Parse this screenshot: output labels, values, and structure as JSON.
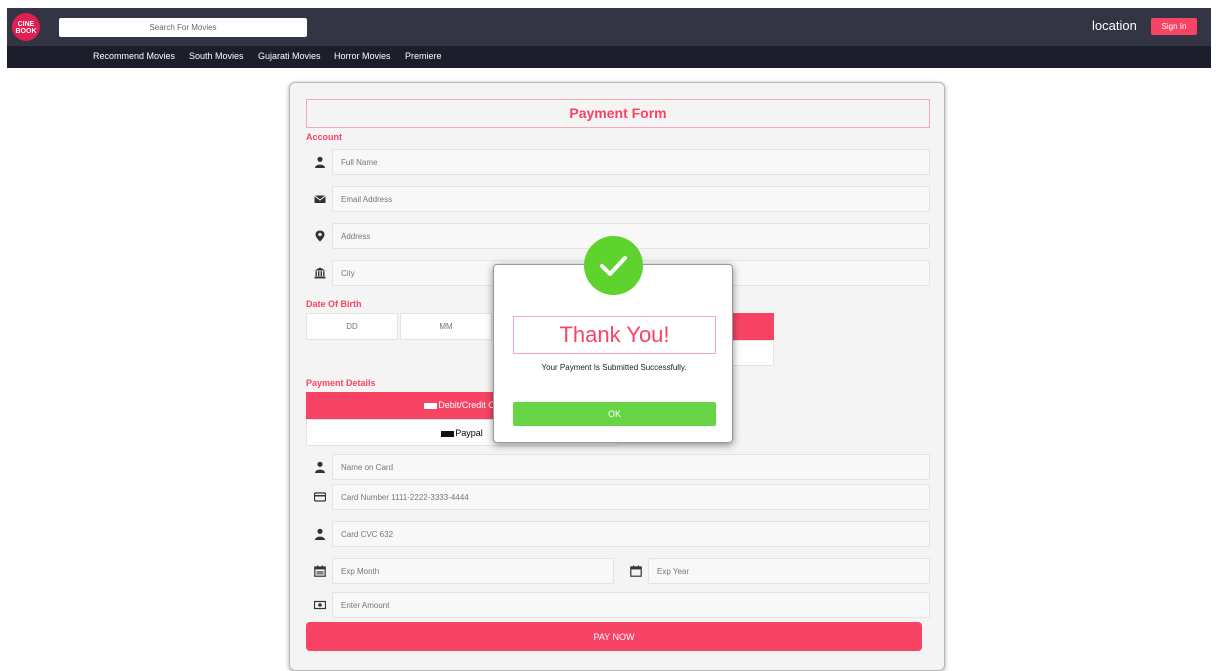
{
  "header": {
    "logo_text_1": "CINE",
    "logo_text_2": "BOOK",
    "search_placeholder": "Search For Movies",
    "location_label": "location",
    "signin_label": "Sign In"
  },
  "nav": {
    "items": [
      "Recommend Movies",
      "South Movies",
      "Gujarati Movies",
      "Horror Movies",
      "Premiere"
    ]
  },
  "form": {
    "title": "Payment Form",
    "account_label": "Account",
    "fields": {
      "full_name": "Full Name",
      "email": "Email Address",
      "address": "Address",
      "city": "City"
    },
    "dob_label": "Date Of Birth",
    "dob": {
      "dd": "DD",
      "mm": "MM"
    },
    "payment_details_label": "Payment Details",
    "tabs": {
      "card": "Debit/Credit Ca",
      "paypal": "Paypal"
    },
    "card_fields": {
      "name_on_card": "Name on Card",
      "card_number": "Card Number 1111-2222-3333-4444",
      "card_cvc": "Card CVC 632",
      "exp_month": "Exp Month",
      "exp_year": "Exp Year",
      "amount": "Enter Amount"
    },
    "pay_now_label": "PAY NOW"
  },
  "modal": {
    "title": "Thank You!",
    "message": "Your Payment Is Submitted Successfully.",
    "ok_label": "OK"
  },
  "colors": {
    "accent": "#f84464",
    "header_bg": "#333545",
    "nav_bg": "#1d1e2b",
    "success": "#5ed32d"
  },
  "icons": [
    "user-icon",
    "envelope-icon",
    "map-pin-icon",
    "bank-icon",
    "credit-card-icon",
    "calendar-icon",
    "money-icon",
    "check-icon"
  ]
}
